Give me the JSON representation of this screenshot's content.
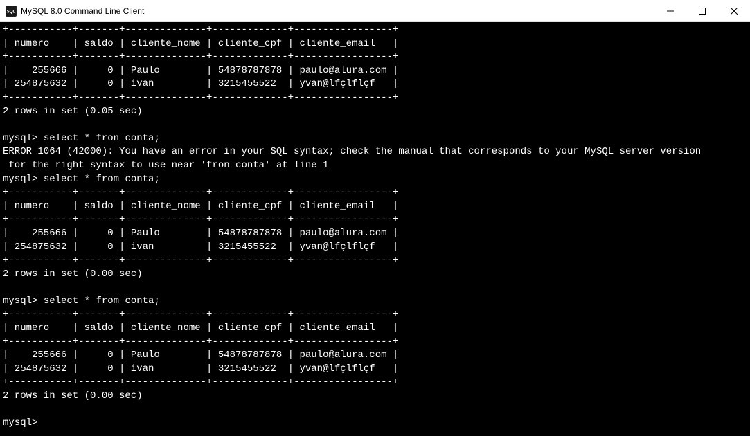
{
  "window": {
    "title": "MySQL 8.0 Command Line Client",
    "icon_label": "MySQL"
  },
  "terminal": {
    "prompt": "mysql>",
    "commands": {
      "select_fron": "select * fron conta;",
      "select_from": "select * from conta;"
    },
    "error": {
      "code": "ERROR 1064 (42000)",
      "line1": "You have an error in your SQL syntax; check the manual that corresponds to your MySQL server version",
      "line2": " for the right syntax to use near 'fron conta' at line 1"
    },
    "result_summary": {
      "first": "2 rows in set (0.05 sec)",
      "second": "2 rows in set (0.00 sec)",
      "third": "2 rows in set (0.00 sec)"
    },
    "table": {
      "border": "+-----------+-------+--------------+-------------+-----------------+",
      "header": "| numero    | saldo | cliente_nome | cliente_cpf | cliente_email   |",
      "row1": "|    255666 |     0 | Paulo        | 54878787878 | paulo@alura.com |",
      "row2": "| 254875632 |     0 | ivan         | 3215455522  | yvan@lfçlflçf   |"
    },
    "final_prompt": "mysql>"
  },
  "chart_data": {
    "type": "table",
    "columns": [
      "numero",
      "saldo",
      "cliente_nome",
      "cliente_cpf",
      "cliente_email"
    ],
    "rows": [
      {
        "numero": 255666,
        "saldo": 0,
        "cliente_nome": "Paulo",
        "cliente_cpf": "54878787878",
        "cliente_email": "paulo@alura.com"
      },
      {
        "numero": 254875632,
        "saldo": 0,
        "cliente_nome": "ivan",
        "cliente_cpf": "3215455522",
        "cliente_email": "yvan@lfçlflçf"
      }
    ]
  }
}
